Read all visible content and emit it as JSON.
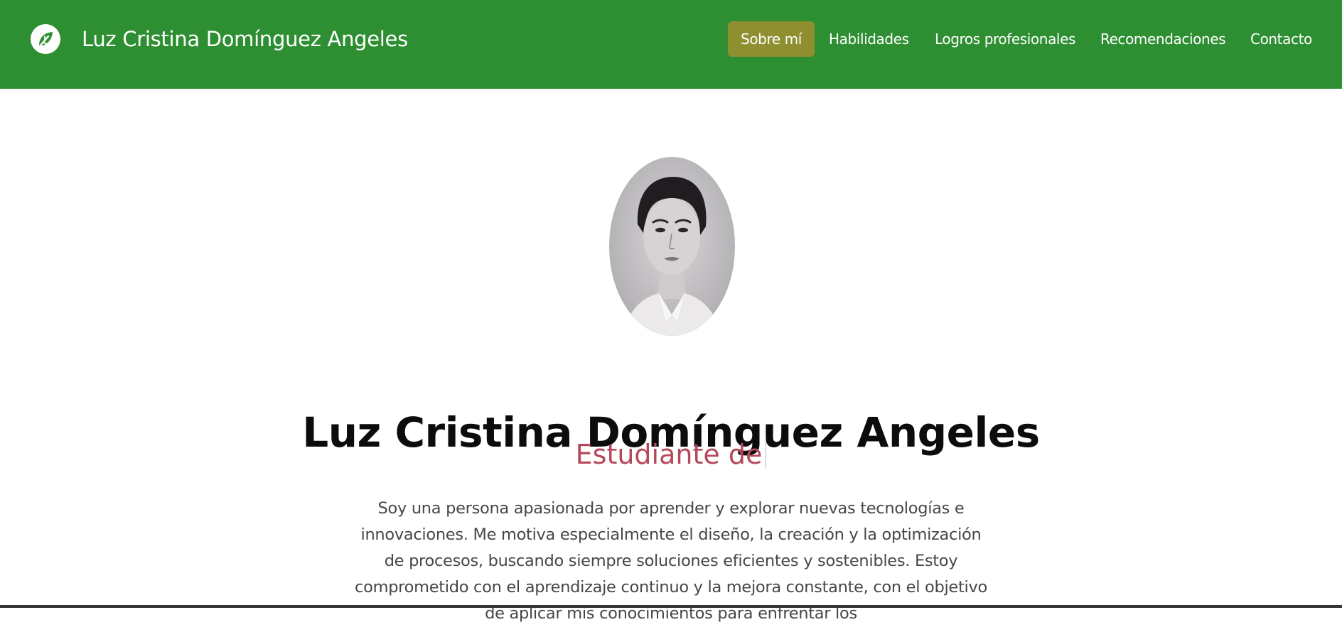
{
  "header": {
    "brand_name": "Luz Cristina Domínguez Angeles",
    "logo_icon": "leaf-logo-icon",
    "nav_items": [
      {
        "label": "Sobre mí",
        "active": true
      },
      {
        "label": "Habilidades",
        "active": false
      },
      {
        "label": "Logros profesionales",
        "active": false
      },
      {
        "label": "Recomendaciones",
        "active": false
      },
      {
        "label": "Contacto",
        "active": false
      }
    ]
  },
  "hero": {
    "name": "Luz Cristina Domínguez Angeles",
    "subtitle": "Estudiante de",
    "bio": "Soy una persona apasionada por aprender y explorar nuevas tecnologías e innovaciones. Me motiva especialmente el diseño, la creación y la optimización de procesos, buscando siempre soluciones eficientes y sostenibles. Estoy comprometido con el aprendizaje continuo y la mejora constante, con el objetivo de aplicar mis conocimientos para enfrentar los"
  },
  "colors": {
    "navbar_bg": "#2e8f32",
    "active_nav_bg": "#8f8f2f",
    "subtitle_text": "#b5495b",
    "body_text": "#474747"
  }
}
